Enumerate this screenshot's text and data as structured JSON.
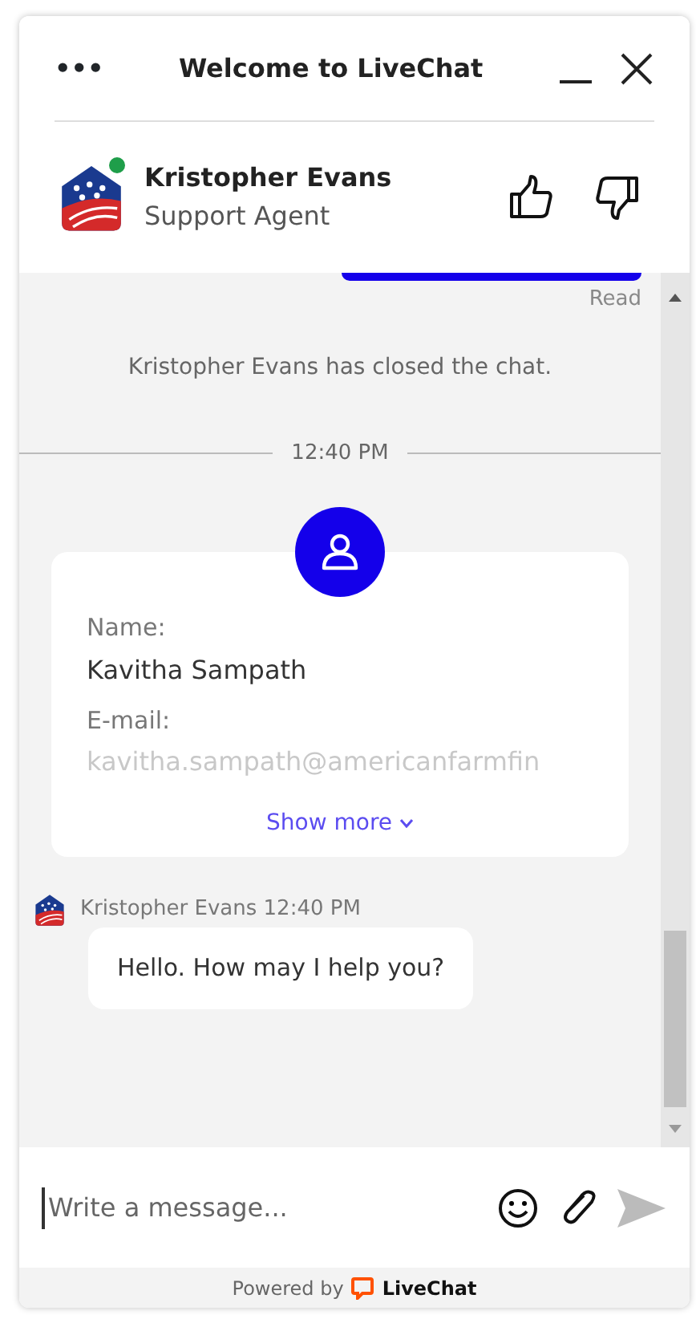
{
  "window": {
    "title": "Welcome to LiveChat",
    "menu_icon": "•••"
  },
  "agent": {
    "name": "Kristopher Evans",
    "role": "Support Agent",
    "online": true
  },
  "messages": [
    {
      "kind": "sent-cut",
      "status": "Read"
    },
    {
      "kind": "system",
      "text": "Kristopher Evans has closed the chat."
    },
    {
      "kind": "divider",
      "text": "12:40 PM"
    },
    {
      "kind": "form",
      "fields": [
        {
          "label": "Name:",
          "value": "Kavitha Sampath",
          "faded": false
        },
        {
          "label": "E-mail:",
          "value": "kavitha.sampath@americanfarmfin",
          "faded": true
        }
      ],
      "more": "Show more"
    },
    {
      "kind": "agent",
      "author": "Kristopher Evans 12:40 PM",
      "text": "Hello. How may I help you?"
    }
  ],
  "composer": {
    "placeholder": "Write a message..."
  },
  "footer": {
    "prefix": "Powered by",
    "brand": "LiveChat"
  }
}
